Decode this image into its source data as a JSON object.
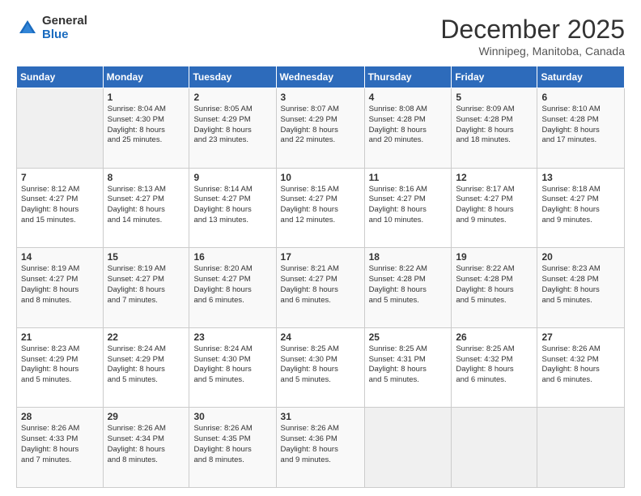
{
  "logo": {
    "general": "General",
    "blue": "Blue"
  },
  "header": {
    "month": "December 2025",
    "subtitle": "Winnipeg, Manitoba, Canada"
  },
  "days_of_week": [
    "Sunday",
    "Monday",
    "Tuesday",
    "Wednesday",
    "Thursday",
    "Friday",
    "Saturday"
  ],
  "weeks": [
    [
      {
        "day": "",
        "info": ""
      },
      {
        "day": "1",
        "info": "Sunrise: 8:04 AM\nSunset: 4:30 PM\nDaylight: 8 hours\nand 25 minutes."
      },
      {
        "day": "2",
        "info": "Sunrise: 8:05 AM\nSunset: 4:29 PM\nDaylight: 8 hours\nand 23 minutes."
      },
      {
        "day": "3",
        "info": "Sunrise: 8:07 AM\nSunset: 4:29 PM\nDaylight: 8 hours\nand 22 minutes."
      },
      {
        "day": "4",
        "info": "Sunrise: 8:08 AM\nSunset: 4:28 PM\nDaylight: 8 hours\nand 20 minutes."
      },
      {
        "day": "5",
        "info": "Sunrise: 8:09 AM\nSunset: 4:28 PM\nDaylight: 8 hours\nand 18 minutes."
      },
      {
        "day": "6",
        "info": "Sunrise: 8:10 AM\nSunset: 4:28 PM\nDaylight: 8 hours\nand 17 minutes."
      }
    ],
    [
      {
        "day": "7",
        "info": "Sunrise: 8:12 AM\nSunset: 4:27 PM\nDaylight: 8 hours\nand 15 minutes."
      },
      {
        "day": "8",
        "info": "Sunrise: 8:13 AM\nSunset: 4:27 PM\nDaylight: 8 hours\nand 14 minutes."
      },
      {
        "day": "9",
        "info": "Sunrise: 8:14 AM\nSunset: 4:27 PM\nDaylight: 8 hours\nand 13 minutes."
      },
      {
        "day": "10",
        "info": "Sunrise: 8:15 AM\nSunset: 4:27 PM\nDaylight: 8 hours\nand 12 minutes."
      },
      {
        "day": "11",
        "info": "Sunrise: 8:16 AM\nSunset: 4:27 PM\nDaylight: 8 hours\nand 10 minutes."
      },
      {
        "day": "12",
        "info": "Sunrise: 8:17 AM\nSunset: 4:27 PM\nDaylight: 8 hours\nand 9 minutes."
      },
      {
        "day": "13",
        "info": "Sunrise: 8:18 AM\nSunset: 4:27 PM\nDaylight: 8 hours\nand 9 minutes."
      }
    ],
    [
      {
        "day": "14",
        "info": "Sunrise: 8:19 AM\nSunset: 4:27 PM\nDaylight: 8 hours\nand 8 minutes."
      },
      {
        "day": "15",
        "info": "Sunrise: 8:19 AM\nSunset: 4:27 PM\nDaylight: 8 hours\nand 7 minutes."
      },
      {
        "day": "16",
        "info": "Sunrise: 8:20 AM\nSunset: 4:27 PM\nDaylight: 8 hours\nand 6 minutes."
      },
      {
        "day": "17",
        "info": "Sunrise: 8:21 AM\nSunset: 4:27 PM\nDaylight: 8 hours\nand 6 minutes."
      },
      {
        "day": "18",
        "info": "Sunrise: 8:22 AM\nSunset: 4:28 PM\nDaylight: 8 hours\nand 5 minutes."
      },
      {
        "day": "19",
        "info": "Sunrise: 8:22 AM\nSunset: 4:28 PM\nDaylight: 8 hours\nand 5 minutes."
      },
      {
        "day": "20",
        "info": "Sunrise: 8:23 AM\nSunset: 4:28 PM\nDaylight: 8 hours\nand 5 minutes."
      }
    ],
    [
      {
        "day": "21",
        "info": "Sunrise: 8:23 AM\nSunset: 4:29 PM\nDaylight: 8 hours\nand 5 minutes."
      },
      {
        "day": "22",
        "info": "Sunrise: 8:24 AM\nSunset: 4:29 PM\nDaylight: 8 hours\nand 5 minutes."
      },
      {
        "day": "23",
        "info": "Sunrise: 8:24 AM\nSunset: 4:30 PM\nDaylight: 8 hours\nand 5 minutes."
      },
      {
        "day": "24",
        "info": "Sunrise: 8:25 AM\nSunset: 4:30 PM\nDaylight: 8 hours\nand 5 minutes."
      },
      {
        "day": "25",
        "info": "Sunrise: 8:25 AM\nSunset: 4:31 PM\nDaylight: 8 hours\nand 5 minutes."
      },
      {
        "day": "26",
        "info": "Sunrise: 8:25 AM\nSunset: 4:32 PM\nDaylight: 8 hours\nand 6 minutes."
      },
      {
        "day": "27",
        "info": "Sunrise: 8:26 AM\nSunset: 4:32 PM\nDaylight: 8 hours\nand 6 minutes."
      }
    ],
    [
      {
        "day": "28",
        "info": "Sunrise: 8:26 AM\nSunset: 4:33 PM\nDaylight: 8 hours\nand 7 minutes."
      },
      {
        "day": "29",
        "info": "Sunrise: 8:26 AM\nSunset: 4:34 PM\nDaylight: 8 hours\nand 8 minutes."
      },
      {
        "day": "30",
        "info": "Sunrise: 8:26 AM\nSunset: 4:35 PM\nDaylight: 8 hours\nand 8 minutes."
      },
      {
        "day": "31",
        "info": "Sunrise: 8:26 AM\nSunset: 4:36 PM\nDaylight: 8 hours\nand 9 minutes."
      },
      {
        "day": "",
        "info": ""
      },
      {
        "day": "",
        "info": ""
      },
      {
        "day": "",
        "info": ""
      }
    ]
  ]
}
